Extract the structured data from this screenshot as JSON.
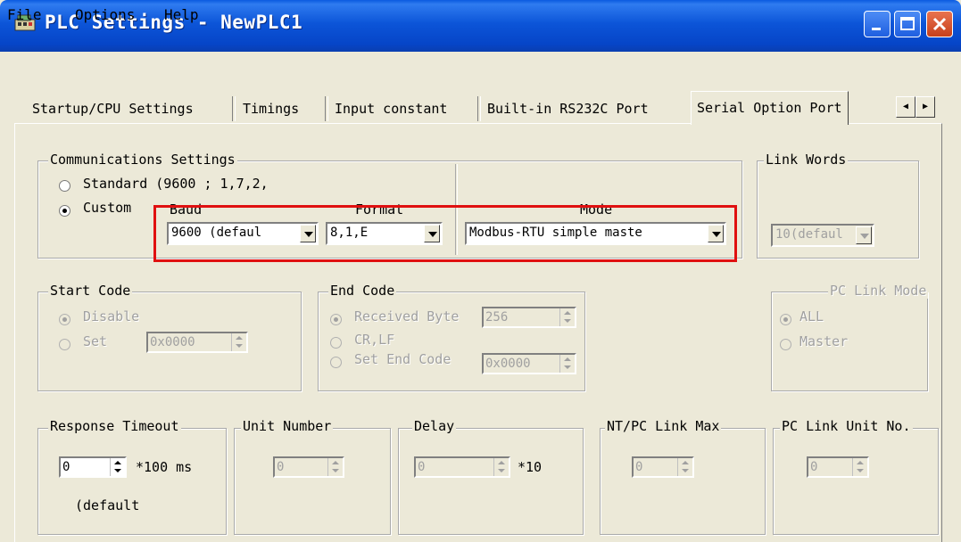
{
  "window": {
    "title": "PLC Settings - NewPLC1",
    "icon": "plc-app-icon",
    "controls": [
      "minimize-icon",
      "maximize-icon",
      "close-icon"
    ]
  },
  "menu": {
    "file": "File",
    "options": "Options",
    "help": "Help"
  },
  "tabs": [
    {
      "label": "Startup/CPU Settings"
    },
    {
      "label": "Timings"
    },
    {
      "label": "Input constant"
    },
    {
      "label": "Built-in RS232C Port"
    },
    {
      "label": "Serial Option Port",
      "active": true
    }
  ],
  "comm": {
    "group_label": "Communications Settings",
    "standard_label": "Standard (9600 ; 1,7,2,",
    "custom_label": "Custom",
    "baud_label": "Baud",
    "baud_value": "9600 (defaul",
    "format_label": "Format",
    "format_value": "8,1,E",
    "mode_label": "Mode",
    "mode_value": "Modbus-RTU simple maste",
    "selected": "custom"
  },
  "link_words": {
    "group_label": "Link Words",
    "value": "10(defaul"
  },
  "start_code": {
    "group_label": "Start Code",
    "disable_label": "Disable",
    "set_label": "Set",
    "set_value": "0x0000"
  },
  "end_code": {
    "group_label": "End Code",
    "received_label": "Received Byte",
    "received_value": "256",
    "crlf_label": "CR,LF",
    "set_end_label": "Set End Code",
    "set_end_value": "0x0000"
  },
  "pc_link_mode": {
    "group_label": "PC Link Mode",
    "all_label": "ALL",
    "master_label": "Master"
  },
  "response_timeout": {
    "group_label": "Response Timeout",
    "value": "0",
    "unit": "*100 ms",
    "note": "(default"
  },
  "unit_number": {
    "group_label": "Unit Number",
    "value": "0"
  },
  "delay": {
    "group_label": "Delay",
    "value": "0",
    "unit": "*10"
  },
  "nt_pc_link_max": {
    "group_label": "NT/PC Link Max",
    "value": "0"
  },
  "pc_link_unit_no": {
    "group_label": "PC Link Unit No.",
    "value": "0"
  },
  "colors": {
    "titlebar": "#0a55d8",
    "highlight": "#e01010",
    "face": "#ece9d8"
  }
}
